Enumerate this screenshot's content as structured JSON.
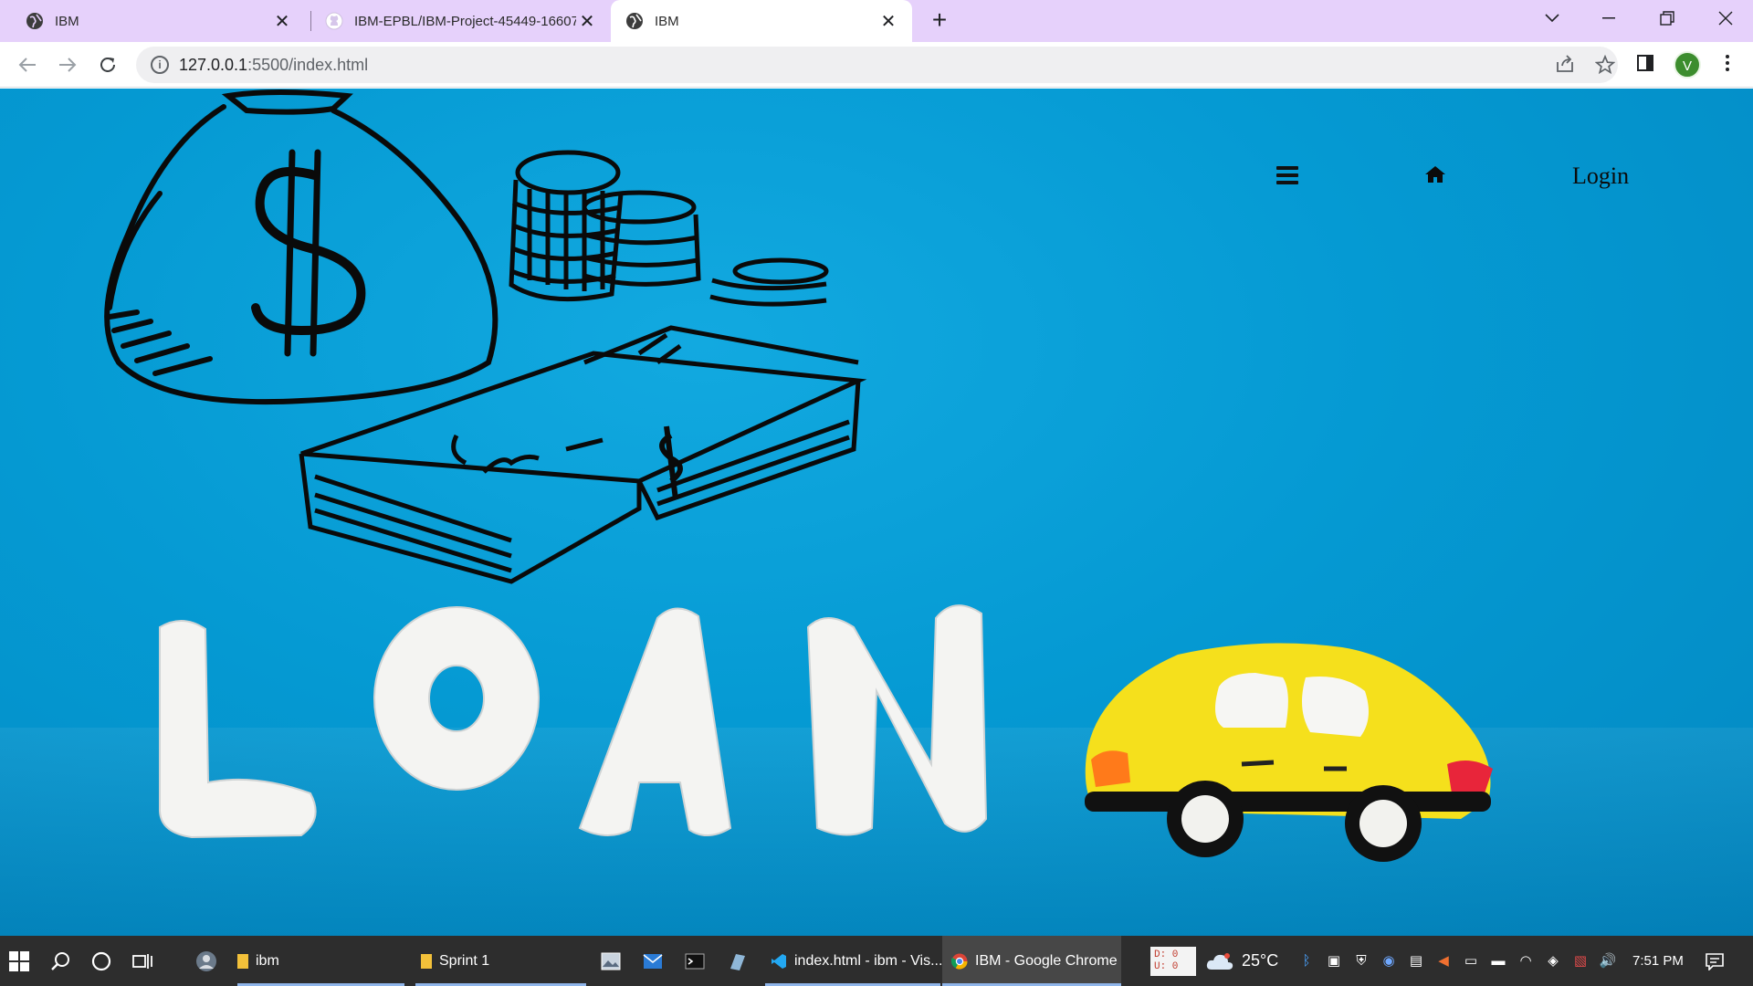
{
  "browser": {
    "tabs": [
      {
        "title": "IBM",
        "favicon": "globe-icon",
        "active": false
      },
      {
        "title": "IBM-EPBL/IBM-Project-45449-16607",
        "favicon": "github-icon",
        "active": false
      },
      {
        "title": "IBM",
        "favicon": "globe-icon",
        "active": true
      }
    ],
    "url_host": "127.0.0.1",
    "url_rest": ":5500/index.html",
    "profile_initial": "V"
  },
  "page": {
    "nav": {
      "login_label": "Login"
    },
    "hero_word": "LOAN",
    "colors": {
      "background": "#059ad3",
      "clay_letters": "#f4f4f2",
      "car_body": "#f5e01c"
    }
  },
  "taskbar": {
    "items": [
      {
        "label": "ibm",
        "icon": "folder-icon"
      },
      {
        "label": "Sprint 1",
        "icon": "folder-icon"
      },
      {
        "label": "index.html - ibm - Vis...",
        "icon": "vscode-icon"
      },
      {
        "label": "IBM - Google Chrome",
        "icon": "chrome-icon"
      }
    ],
    "net_d": "D: 0",
    "net_u": "U: 0",
    "temperature": "25°C",
    "time": "7:51 PM"
  }
}
